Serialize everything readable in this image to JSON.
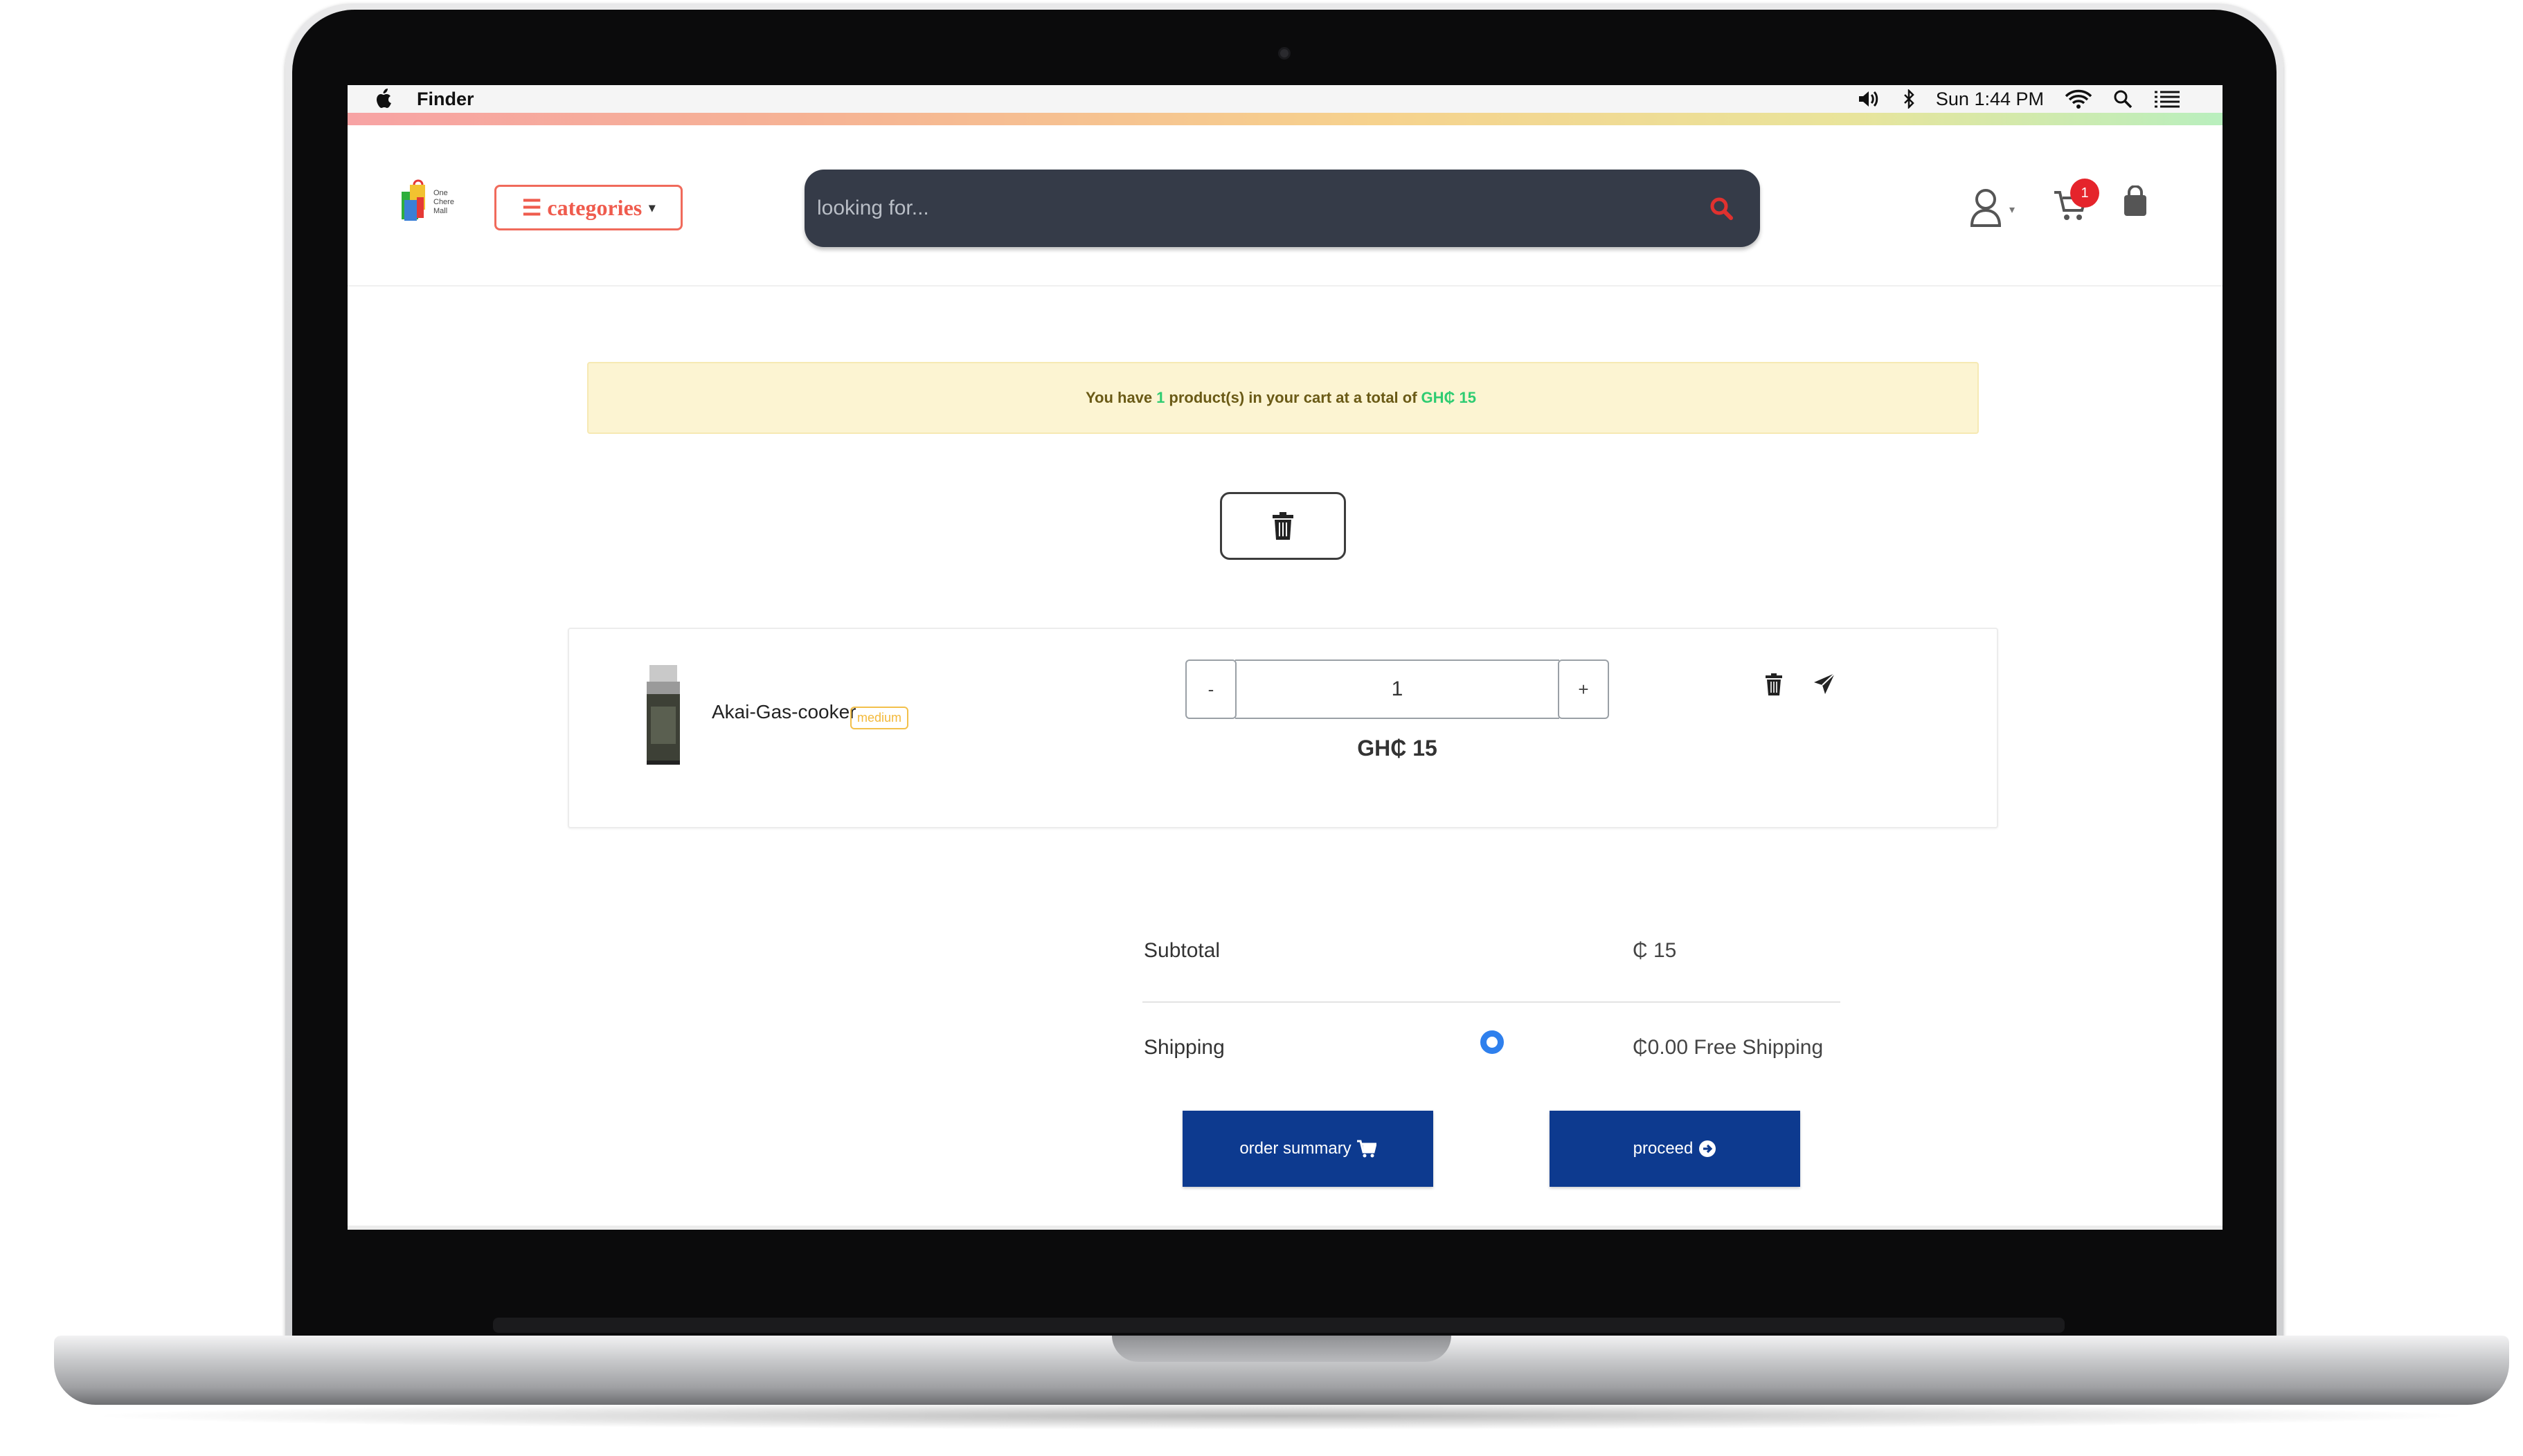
{
  "menubar": {
    "app": "Finder",
    "clock": "Sun 1:44 PM",
    "icons": [
      "apple-icon",
      "volume-icon",
      "bluetooth-icon",
      "wifi-icon",
      "spotlight-icon",
      "notification-list-icon"
    ]
  },
  "header": {
    "logo_text": [
      "One",
      "Chere",
      "Mall"
    ],
    "categories_label": "☰ categories",
    "search_placeholder": "looking for...",
    "cart_count": "1",
    "icons": [
      "search-icon",
      "user-icon",
      "cart-icon",
      "shopping-bag-icon"
    ]
  },
  "cart": {
    "alert": {
      "prefix": "You have",
      "count": "1",
      "middle": "product(s) in your cart at a total of",
      "total": "GH₵ 15"
    },
    "items": [
      {
        "name": "Akai-Gas-cooker",
        "size": "medium",
        "quantity": "1",
        "minus_label": "-",
        "plus_label": "+",
        "price": "GH₵ 15"
      }
    ],
    "summary": {
      "subtotal_label": "Subtotal",
      "subtotal_value": "₵ 15",
      "shipping_label": "Shipping",
      "shipping_value": "₵0.00 Free Shipping"
    },
    "buttons": {
      "order_summary": "order summary",
      "proceed": "proceed"
    }
  },
  "colors": {
    "accent_red": "#ef5b4d",
    "search_bg": "#353b48",
    "button_blue": "#0d3a8f",
    "alert_bg": "#fcf4d2",
    "highlight_green": "#2ecc71",
    "badge_yellow": "#f3b93a"
  }
}
